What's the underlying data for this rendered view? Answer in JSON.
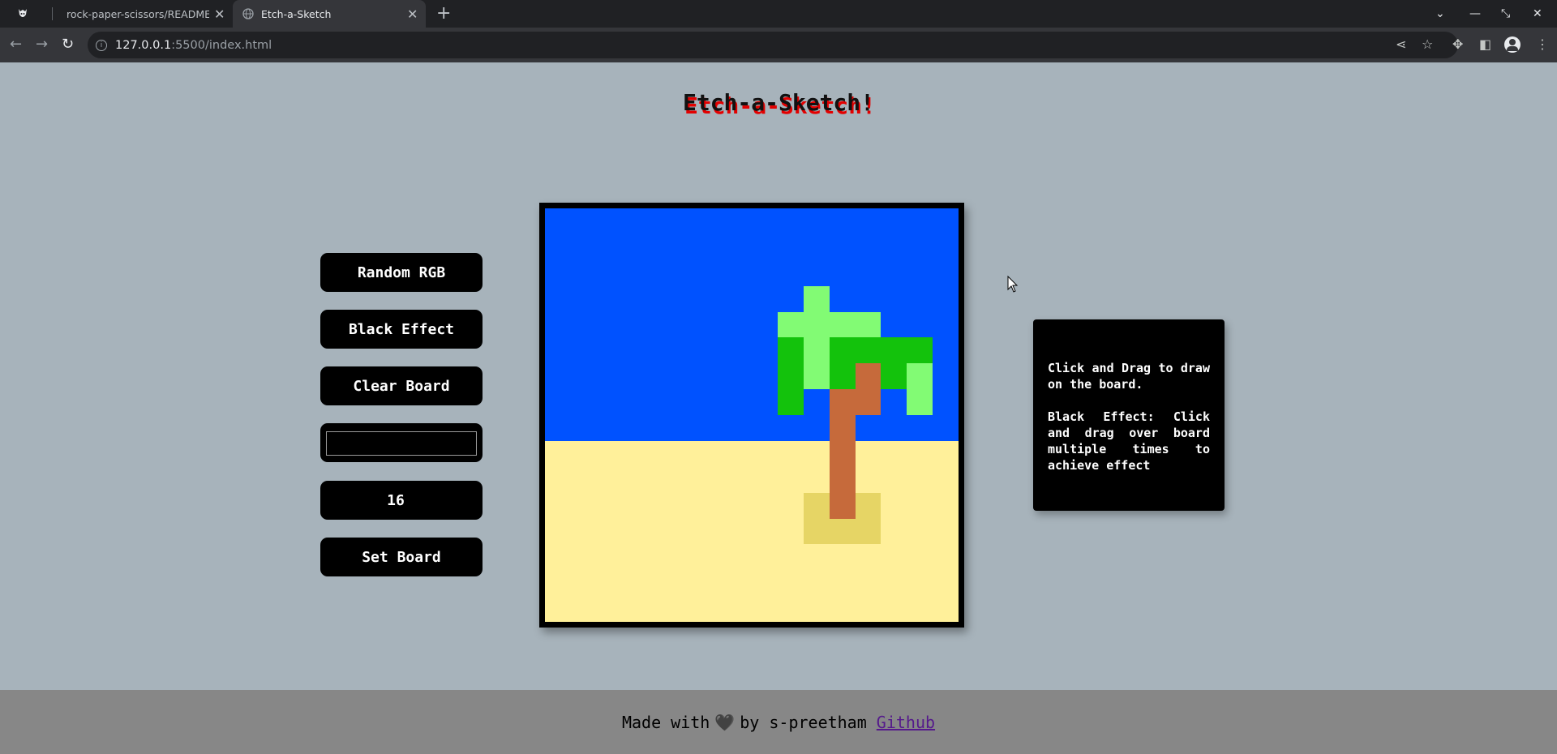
{
  "browser": {
    "tabs": [
      {
        "title": "rock-paper-scissors/README.m",
        "active": false
      },
      {
        "title": "Etch-a-Sketch",
        "active": true
      }
    ],
    "url_host": "127.0.0.1",
    "url_path": ":5500/index.html"
  },
  "page": {
    "title": "Etch-a-Sketch!",
    "title_shadow_color": "#e30000"
  },
  "controls": {
    "random_rgb": "Random RGB",
    "black_effect": "Black Effect",
    "clear_board": "Clear Board",
    "size_input_value": "",
    "size_value": "16",
    "set_board": "Set Board"
  },
  "board": {
    "size": 16,
    "palette": {
      "S": "#0052ff",
      "A": "#fff09a",
      "L": "#82fb74",
      "D": "#13c20c",
      "T": "#c66a3b",
      "M": "#e6d565"
    },
    "rows": [
      "SSSSSSSSSSSSSSSS",
      "SSSSSSSSSSSSSSSS",
      "SSSSSSSSSSSSSSSS",
      "SSSSSSSSSSLSSSSS",
      "SSSSSSSSSLLLLSSS",
      "SSSSSSSSSDLDDDDS",
      "SSSSSSSSSDLDTDLS",
      "SSSSSSSSSDSTTSLS",
      "SSSSSSSSSSSTSSSS",
      "AAAAAAAAAAATAAAA",
      "AAAAAAAAAAATAAAA",
      "AAAAAAAAAAMTMAAA",
      "AAAAAAAAAAMMMAAA",
      "AAAAAAAAAAAAAAAA",
      "AAAAAAAAAAAAAAAA",
      "AAAAAAAAAAAAAAAA"
    ]
  },
  "info": {
    "line1": "Click and Drag to draw on the board.",
    "line2": "Black Effect: Click and drag over board multiple times to achieve effect"
  },
  "footer": {
    "prefix": "Made with",
    "middle": "by s-preetham",
    "link_text": "Github"
  }
}
